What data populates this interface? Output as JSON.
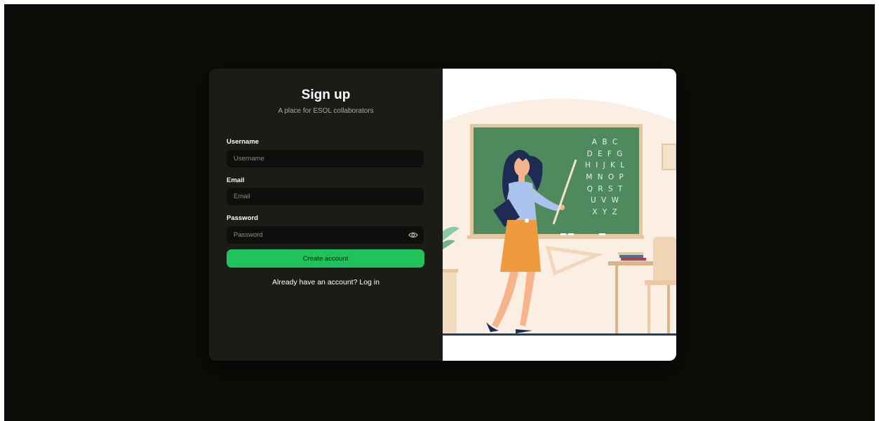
{
  "signup": {
    "title": "Sign up",
    "subtitle": "A place for ESOL collaborators",
    "username_label": "Username",
    "username_placeholder": "Username",
    "username_value": "",
    "email_label": "Email",
    "email_placeholder": "Email",
    "email_value": "",
    "password_label": "Password",
    "password_placeholder": "Password",
    "password_value": "",
    "submit_label": "Create account",
    "login_text": "Already have an account? Log in"
  },
  "illustration": {
    "board_rows": [
      "A B C",
      "D E F G",
      "H I J K L",
      "M N O P",
      "Q R S T",
      "U V W",
      "X Y Z"
    ]
  },
  "colors": {
    "accent": "#21c25c",
    "panel": "#1b1c18",
    "backdrop": "#0c0d09",
    "chalkboard": "#4f8a5e"
  },
  "icons": {
    "password_toggle": "eye-icon"
  }
}
